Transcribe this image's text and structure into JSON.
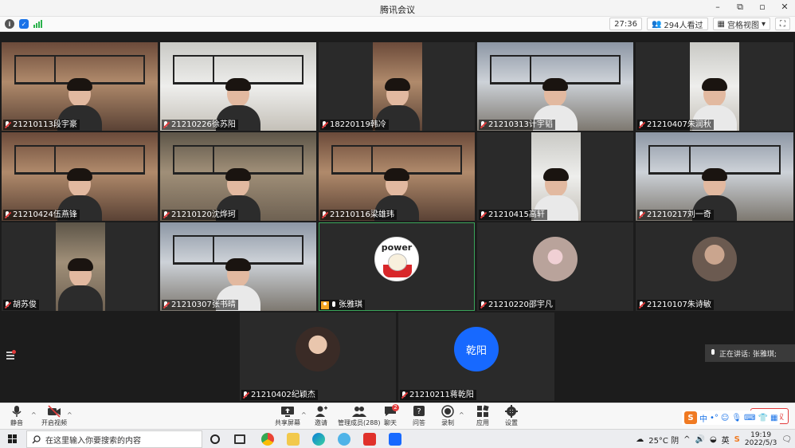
{
  "window": {
    "title": "腾讯会议",
    "minimize": "–",
    "maximize": "▫",
    "restore": "⧉",
    "close": "✕"
  },
  "status": {
    "timer": "27:36",
    "viewers": "294人看过",
    "view_mode": "宫格视图",
    "view_caret": "▾",
    "info_icon": "info-icon",
    "shield_icon": "shield-icon"
  },
  "participants": [
    {
      "name": "21210113段宇豪",
      "muted": true
    },
    {
      "name": "21210226徐苏阳",
      "muted": true
    },
    {
      "name": "18220119韩冷",
      "muted": true
    },
    {
      "name": "21210313计宇韬",
      "muted": true
    },
    {
      "name": "21210407朱润秋",
      "muted": true
    },
    {
      "name": "21210424伍燕锋",
      "muted": true
    },
    {
      "name": "21210120沈烨珂",
      "muted": true
    },
    {
      "name": "21210116梁雄玮",
      "muted": true
    },
    {
      "name": "21210415高轩",
      "muted": true
    },
    {
      "name": "21210217刘一奇",
      "muted": true
    },
    {
      "name": "胡苏俊",
      "muted": true
    },
    {
      "name": "21210307张书晴",
      "muted": true
    },
    {
      "name": "张雅琪",
      "muted": false,
      "host": true,
      "avatar_text": "power"
    },
    {
      "name": "21210220邵宇凡",
      "muted": true
    },
    {
      "name": "21210107朱诗敏",
      "muted": true
    },
    {
      "name": "21210402纪颖杰",
      "muted": true
    },
    {
      "name": "21210211蒋乾阳",
      "muted": true,
      "avatar_text": "乾阳"
    }
  ],
  "speaking": {
    "text": "正在讲话: 张雅琪;"
  },
  "toolbar": {
    "mute": "静音",
    "video": "开启视频",
    "share": "共享屏幕",
    "invite": "邀请",
    "members": "管理成员(288)",
    "chat": "聊天",
    "chat_badge": "2",
    "qa": "问答",
    "record": "录制",
    "apps": "应用",
    "settings": "设置",
    "end": "结束会议",
    "caret": "^"
  },
  "ime": {
    "logo": "S",
    "lang": "中",
    "punct": "•°",
    "emoji": "☺",
    "mic": "🎙",
    "kbd": "⌨",
    "skin": "👕",
    "grid": "▦"
  },
  "taskbar": {
    "search_placeholder": "在这里输入你要搜索的内容",
    "weather": "25°C 阴",
    "lang": "英",
    "time": "19:19",
    "date": "2022/5/3",
    "notify_icon": "notification-icon"
  }
}
